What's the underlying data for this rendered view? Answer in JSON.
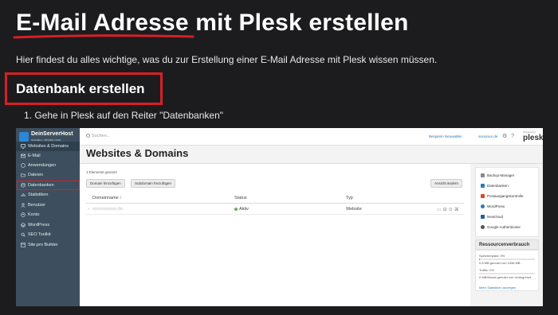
{
  "title": "E-Mail Adresse mit Plesk erstellen",
  "intro": "Hier findest du alles wichtige, was du zur Erstellung einer E-Mail Adresse mit Plesk wissen müssen.",
  "section_title": "Datenbank erstellen",
  "steps": [
    "1. Gehe in Plesk auf den Reiter \"Datenbanken\""
  ],
  "colors": {
    "background": "#1c1c1e",
    "highlight_red": "#d81f26",
    "sidebar": "#3d4f5e",
    "status_green": "#6ab04c"
  },
  "plesk": {
    "logo": {
      "title": "DeinServerHost",
      "subtitle": "SCHNELL • SICHER • FAIR"
    },
    "nav": [
      {
        "label": "Websites & Domains",
        "icon": "monitor-icon",
        "active": true
      },
      {
        "label": "E-Mail",
        "icon": "mail-icon"
      },
      {
        "label": "Anwendungen",
        "icon": "apps-icon"
      },
      {
        "label": "Dateien",
        "icon": "folder-icon"
      },
      {
        "label": "Datenbanken",
        "icon": "database-icon"
      },
      {
        "label": "Statistiken",
        "icon": "chart-icon"
      },
      {
        "label": "Benutzer",
        "icon": "user-icon"
      },
      {
        "label": "Konto",
        "icon": "account-icon"
      },
      {
        "label": "WordPress",
        "icon": "wordpress-icon"
      },
      {
        "label": "SEO Toolkit",
        "icon": "seo-icon"
      },
      {
        "label": "Site.pro Builder",
        "icon": "builder-icon"
      }
    ],
    "search_placeholder": "Suchen...",
    "topbar": {
      "user": "Benjamin Neuwalder",
      "subscription": "xxxxxxxx.de",
      "powered_by": "Powered by",
      "brand": "plesk"
    },
    "heading": "Websites & Domains",
    "element_count": "1 Elemente gesamt",
    "buttons": {
      "add_domain": "Domain hinzufügen",
      "add_subdomain": "Subdomain hinzufügen",
      "change_view": "Ansicht ändern"
    },
    "columns": {
      "domain": "Domainname ↑",
      "status": "Status",
      "type": "Typ"
    },
    "rows": [
      {
        "domain": "xxxxxxxxxxx.de",
        "status": "Aktiv",
        "type": "Website"
      }
    ],
    "quick_links": [
      "Backup-Manager",
      "Datenbanken",
      "Postausgangskontrolle",
      "WordPress",
      "Nextcloud",
      "Google Authenticator"
    ],
    "resources": {
      "title": "Ressourcenverbrauch",
      "disk_label": "Speicherplatz: 0%",
      "disk_value": "0.8 MB genutzt von 1536 MB",
      "disk_fraction": 0.01,
      "traffic_label": "Traffic: 0%",
      "traffic_value": "0 MB/Monat genutzt von Unbegrenzt",
      "traffic_fraction": 0.0,
      "link": "Mehr Statistiken anzeigen"
    }
  }
}
